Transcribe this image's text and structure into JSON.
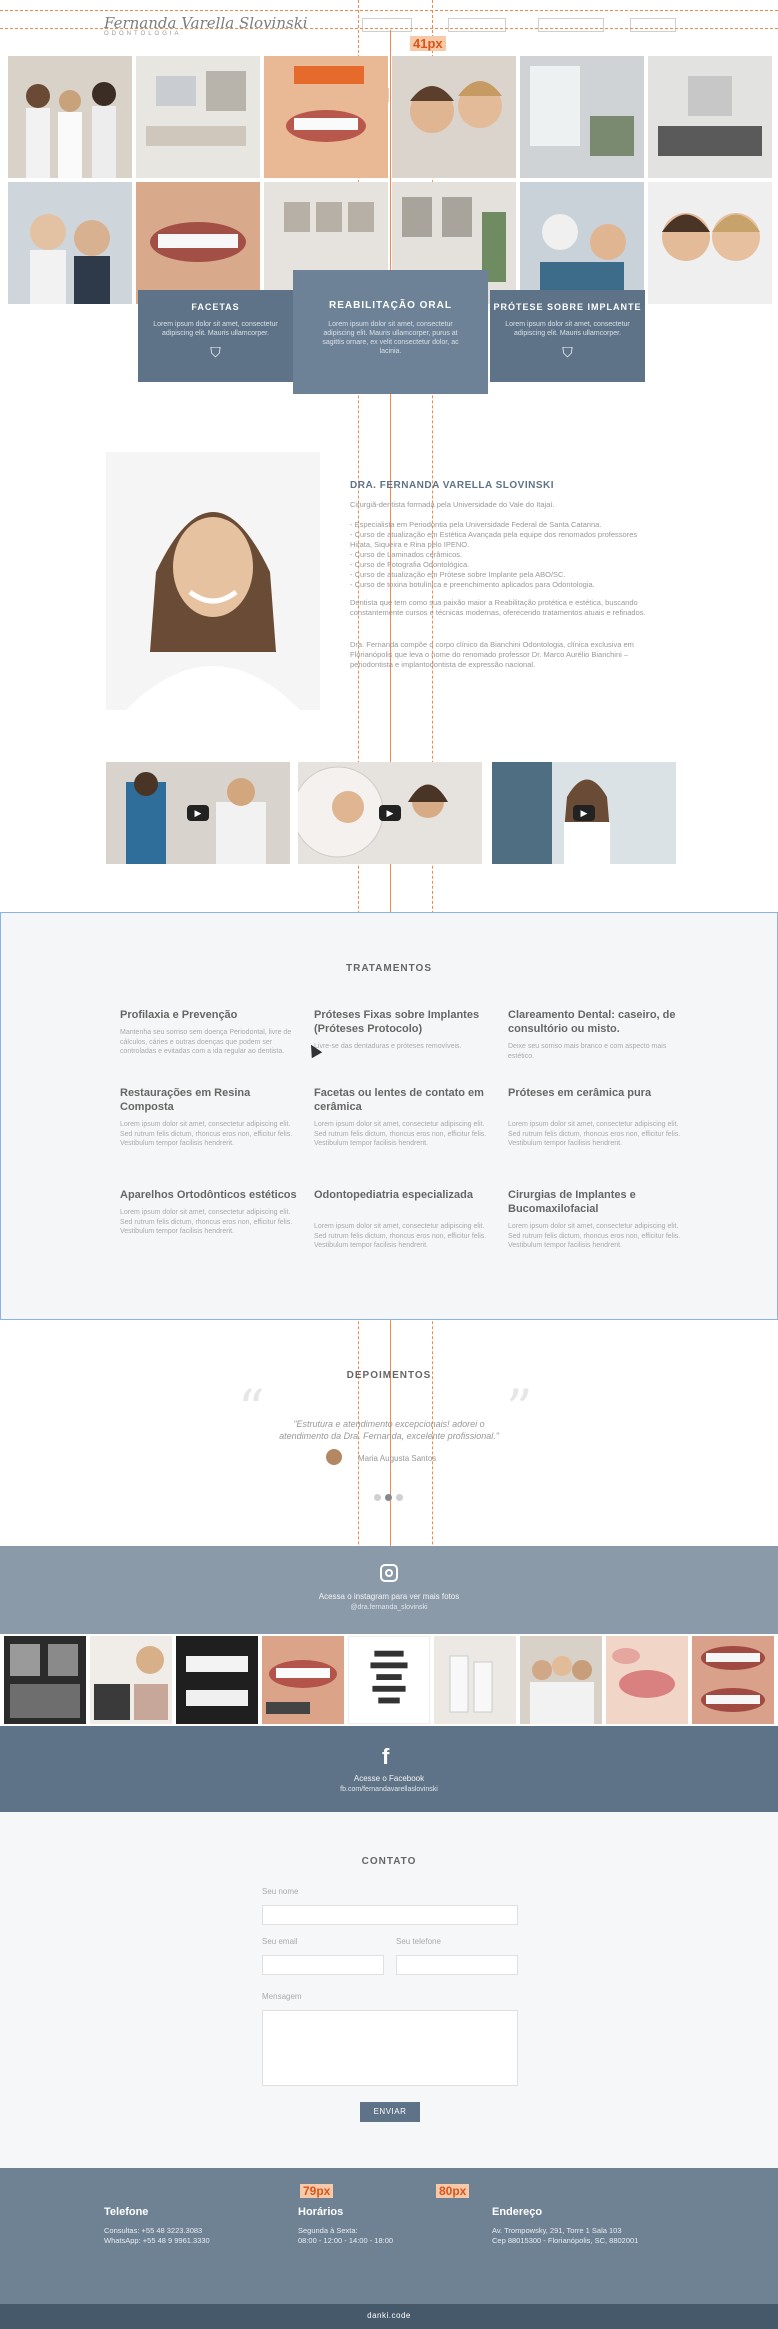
{
  "header": {
    "logo": "Fernanda Varella Slovinski",
    "logo_sub": "ODONTOLOGIA",
    "nav": [
      "",
      "",
      "",
      ""
    ]
  },
  "measures": {
    "top_gap": "41px",
    "gallery_gap": "53px",
    "footer_gap_a": "79px",
    "footer_gap_b": "80px"
  },
  "services": [
    {
      "title": "FACETAS",
      "text": "Lorem ipsum dolor sit amet, consectetur adipiscing elit. Mauris ullamcorper.",
      "icon": "tooth-icon"
    },
    {
      "title": "REABILITAÇÃO ORAL",
      "text": "Lorem ipsum dolor sit amet, consectetur adipiscing elit. Mauris ullamcorper, purus at sagittis ornare, ex velit consectetur dolor, ac lacinia.",
      "icon": "tooth-icon"
    },
    {
      "title": "PRÓTESE SOBRE IMPLANTE",
      "text": "Lorem ipsum dolor sit amet, consectetur adipiscing elit. Mauris ullamcorper.",
      "icon": "tooth-icon"
    }
  ],
  "about": {
    "title": "DRA. FERNANDA VARELLA SLOVINSKI",
    "p1": "Cirurgiã-dentista formada pela Universidade do Vale do Itajaí.",
    "list": [
      "- Especialista em Periodontia pela Universidade Federal de Santa Catarina.",
      "- Curso de atualização em Estética Avançada pela equipe dos renomados professores Hirata, Siqueira e Rina pelo IPENO.",
      "- Curso de Laminados cerâmicos.",
      "- Curso de Fotografia Odontológica.",
      "- Curso de atualização em Prótese sobre Implante pela ABO/SC.",
      "- Curso de toxina botulínica e preenchimento aplicados para Odontologia."
    ],
    "p2": "Dentista que tem como sua paixão maior a Reabilitação protética e estética, buscando constantemente cursos e técnicas modernas, oferecendo tratamentos atuais e refinados.",
    "p3": "Dra. Fernanda compõe o corpo clínico da Bianchini Odontologia, clínica exclusiva em Florianópolis que leva o nome do renomado professor Dr. Marco Aurélio Bianchini – periodontista e implantodontista de expressão nacional."
  },
  "treatments": {
    "title": "TRATAMENTOS",
    "items": [
      {
        "title": "Profilaxia e Prevenção",
        "text": "Mantenha seu sorriso sem doença Periodontal, livre de cálculos, cáries e outras doenças que podem ser controladas e evitadas com a ida regular ao dentista."
      },
      {
        "title": "Próteses Fixas sobre Implantes (Próteses Protocolo)",
        "text": "Livre-se das dentaduras e próteses removíveis."
      },
      {
        "title": "Clareamento Dental: caseiro, de consultório ou misto.",
        "text": "Deixe seu sorriso mais branco e com aspecto mais estético."
      },
      {
        "title": "Restaurações em Resina Composta",
        "text": "Lorem ipsum dolor sit amet, consectetur adipiscing elit. Sed rutrum felis dictum, rhoncus eros non, efficitur felis. Vestibulum tempor facilisis hendrerit."
      },
      {
        "title": "Facetas ou lentes de contato em cerâmica",
        "text": "Lorem ipsum dolor sit amet, consectetur adipiscing elit. Sed rutrum felis dictum, rhoncus eros non, efficitur felis. Vestibulum tempor facilisis hendrerit."
      },
      {
        "title": "Próteses em cerâmica pura",
        "text": "Lorem ipsum dolor sit amet, consectetur adipiscing elit. Sed rutrum felis dictum, rhoncus eros non, efficitur felis. Vestibulum tempor facilisis hendrerit."
      },
      {
        "title": "Aparelhos Ortodônticos estéticos",
        "text": "Lorem ipsum dolor sit amet, consectetur adipiscing elit. Sed rutrum felis dictum, rhoncus eros non, efficitur felis. Vestibulum tempor facilisis hendrerit."
      },
      {
        "title": "Odontopediatria especializada",
        "text": "Lorem ipsum dolor sit amet, consectetur adipiscing elit. Sed rutrum felis dictum, rhoncus eros non, efficitur felis. Vestibulum tempor facilisis hendrerit."
      },
      {
        "title": "Cirurgias de Implantes e Bucomaxilofacial",
        "text": "Lorem ipsum dolor sit amet, consectetur adipiscing elit. Sed rutrum felis dictum, rhoncus eros non, efficitur felis. Vestibulum tempor facilisis hendrerit."
      }
    ]
  },
  "testimonials": {
    "title": "DEPOIMENTOS",
    "quote": "\"Estrutura e atendimento excepcionais! adorei o atendimento da Dra. Fernanda, excelente profissional.\"",
    "author": "Maria Augusta Santos"
  },
  "instagram": {
    "text": "Acessa o instagram para ver mais fotos",
    "handle": "@dra.fernanda_slovinski"
  },
  "facebook": {
    "text": "Acesse o Facebook",
    "url": "fb.com/fernandavarellaslovinski"
  },
  "contact": {
    "title": "CONTATO",
    "name_label": "Seu nome",
    "email_label": "Seu email",
    "phone_label": "Seu telefone",
    "message_label": "Mensagem",
    "submit": "ENVIAR"
  },
  "footer": {
    "phone_title": "Telefone",
    "phone_lines": [
      "Consultas: +55 48 3223.3083",
      "WhatsApp: +55 48 9 9961.3330"
    ],
    "hours_title": "Horários",
    "hours_lines": [
      "Segunda à Sexta:",
      "08:00 - 12:00 - 14:00 - 18:00"
    ],
    "address_title": "Endereço",
    "address_lines": [
      "Av. Trompowsky, 291, Torre 1 Sala 103",
      "Cep 88015300 - Florianópolis, SC, 8802001"
    ],
    "credit": "danki.code"
  },
  "colors": {
    "primary": "#5e7387",
    "instagram_band": "#8b9aa8",
    "footer": "#6f8294",
    "guide": "#f08a4b"
  }
}
